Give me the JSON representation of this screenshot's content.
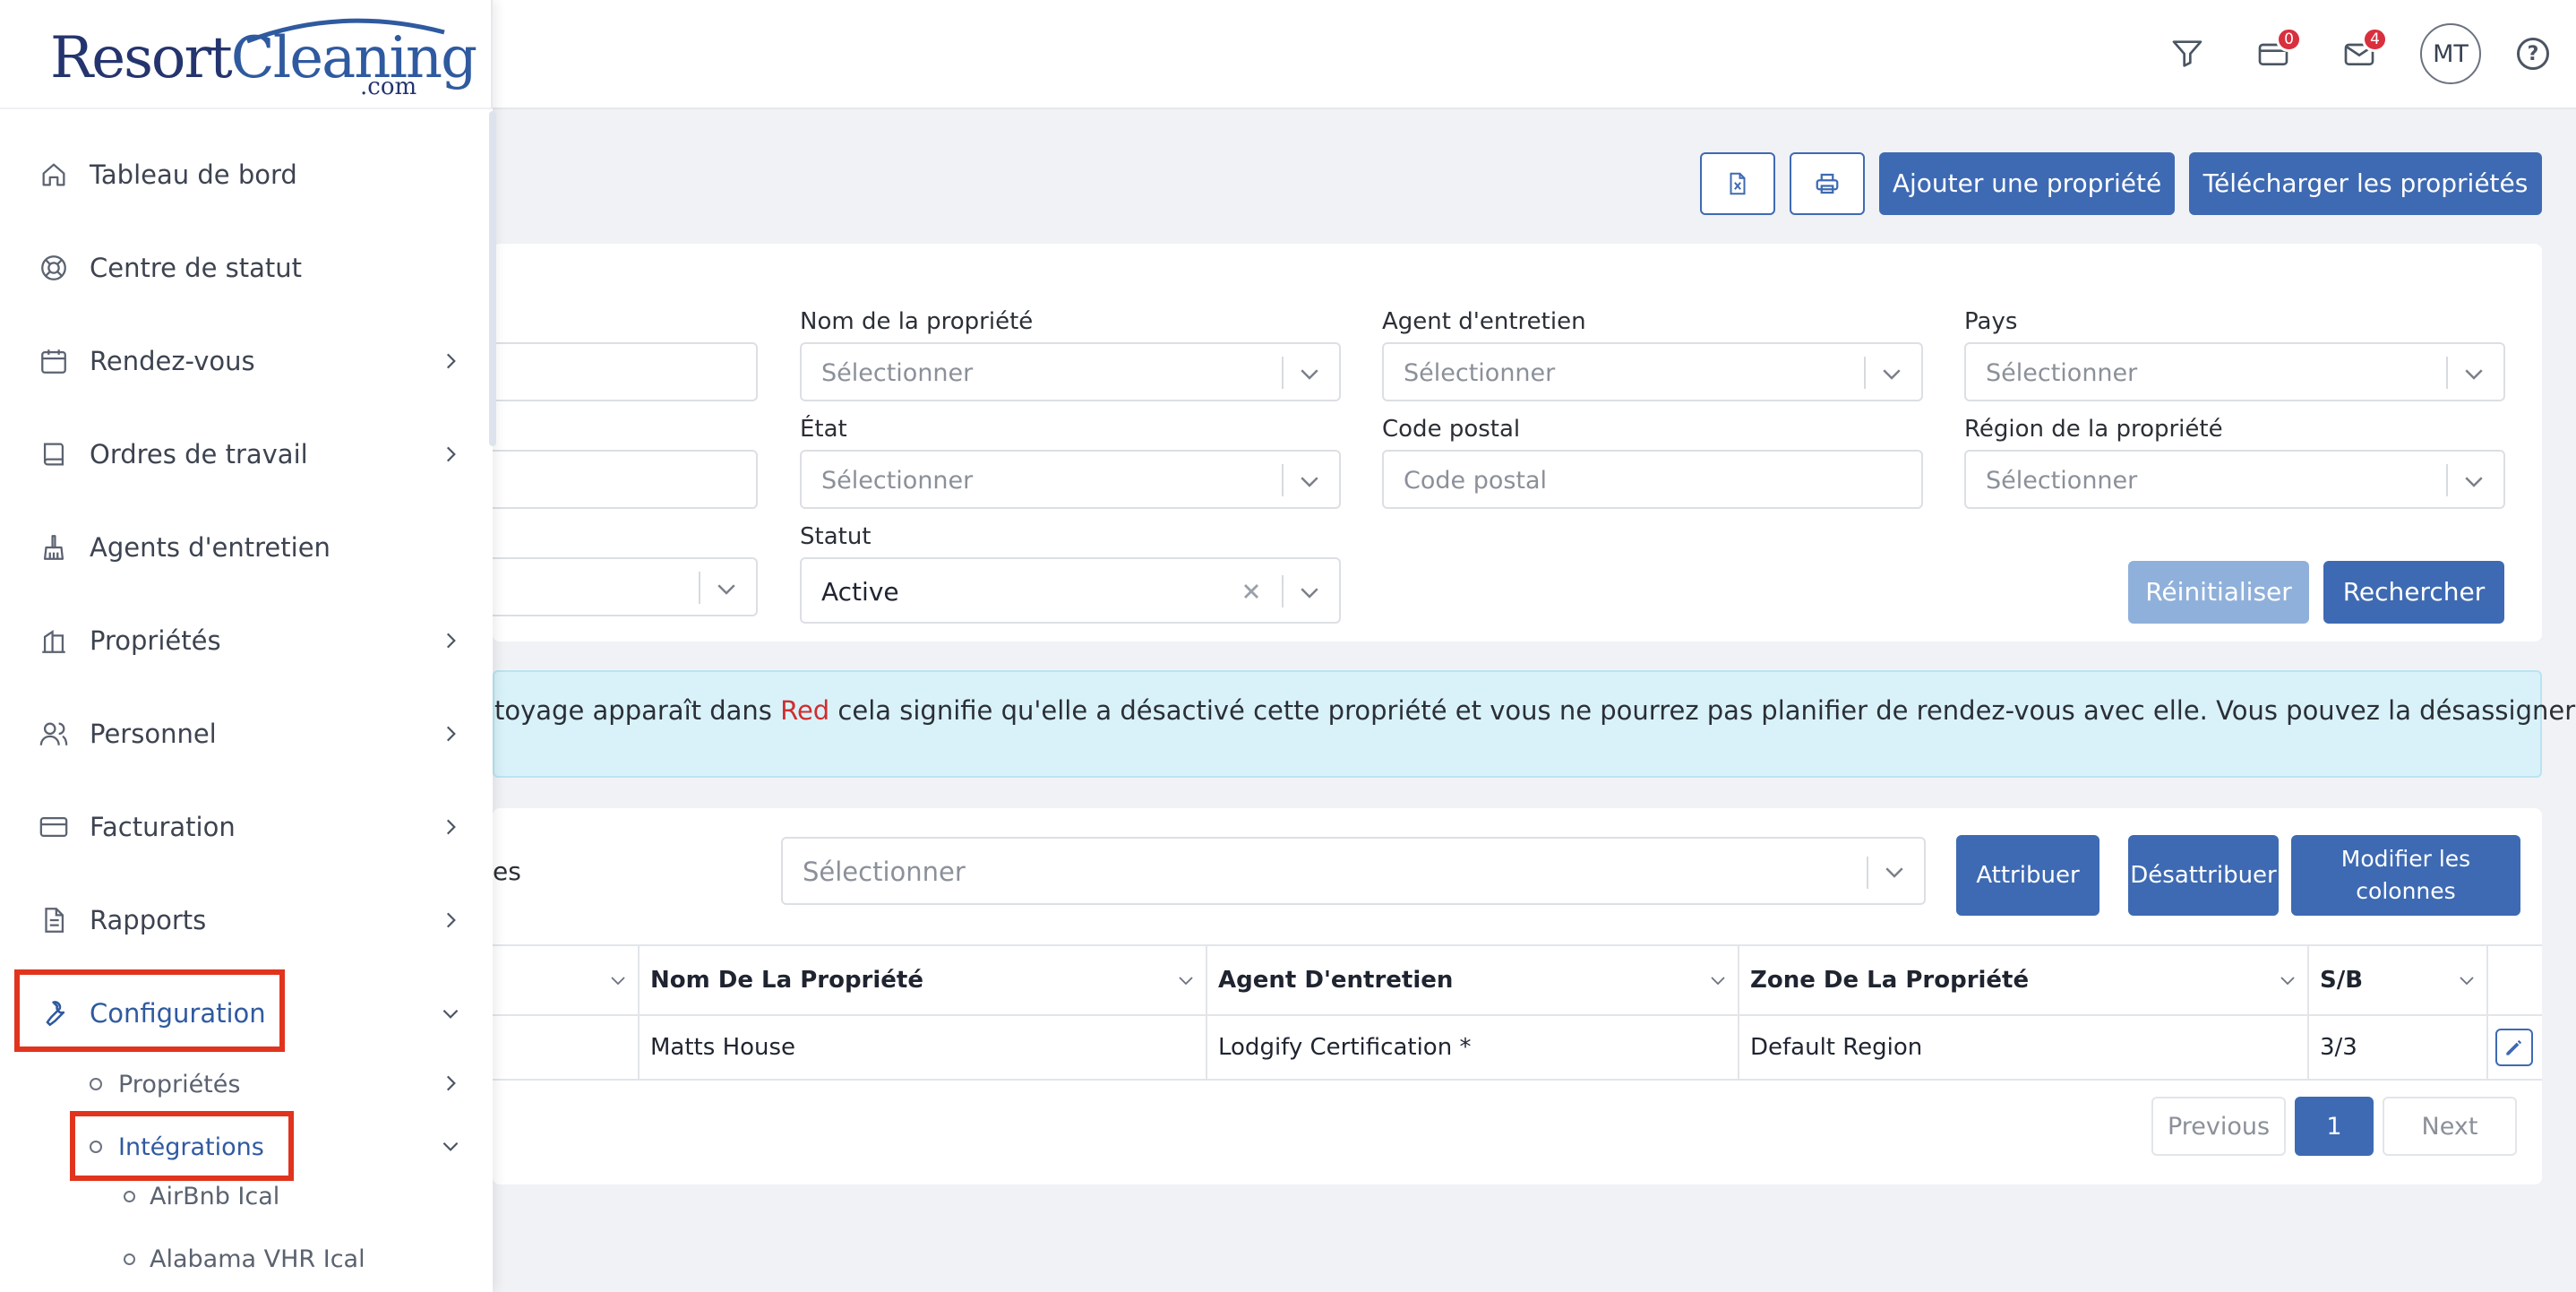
{
  "brand": {
    "logo_part1": "Resort",
    "logo_part2": "Cleaning",
    "logo_suffix": ".com"
  },
  "header": {
    "badges": {
      "cards": "0",
      "mail": "4"
    },
    "avatar_initials": "MT",
    "help_glyph": "?",
    "icons": [
      "filter-icon",
      "card-icon",
      "mail-icon",
      "help-icon"
    ]
  },
  "sidebar": {
    "items": [
      {
        "label": "Tableau de bord",
        "icon": "home-icon"
      },
      {
        "label": "Centre de statut",
        "icon": "lifebuoy-icon"
      },
      {
        "label": "Rendez-vous",
        "icon": "calendar-icon"
      },
      {
        "label": "Ordres de travail",
        "icon": "book-icon"
      },
      {
        "label": "Agents d'entretien",
        "icon": "broom-icon"
      },
      {
        "label": "Propriétés",
        "icon": "building-icon"
      },
      {
        "label": "Personnel",
        "icon": "users-icon"
      },
      {
        "label": "Facturation",
        "icon": "credit-card-icon"
      },
      {
        "label": "Rapports",
        "icon": "report-icon"
      },
      {
        "label": "Configuration",
        "icon": "wrench-icon"
      }
    ],
    "configuration_sub": [
      {
        "label": "Propriétés"
      },
      {
        "label": "Intégrations"
      }
    ],
    "integrations_sub": [
      {
        "label": "AirBnb Ical"
      },
      {
        "label": "Alabama VHR Ical"
      }
    ]
  },
  "toolbar": {
    "excel_icon": "excel-export-icon",
    "print_icon": "print-icon",
    "add_label": "Ajouter une propriété",
    "download_label": "Télécharger les propriétés"
  },
  "filters": {
    "property_name": {
      "label": "Nom de la propriété",
      "placeholder": "Sélectionner"
    },
    "agent": {
      "label": "Agent d'entretien",
      "placeholder": "Sélectionner"
    },
    "country": {
      "label": "Pays",
      "placeholder": "Sélectionner"
    },
    "state": {
      "label": "État",
      "placeholder": "Sélectionner"
    },
    "postal": {
      "label": "Code postal",
      "placeholder": "Code postal"
    },
    "region": {
      "label": "Région de la propriété",
      "placeholder": "Sélectionner"
    },
    "status": {
      "label": "Statut",
      "value": "Active"
    },
    "reset_label": "Réinitialiser",
    "search_label": "Rechercher"
  },
  "notice": {
    "text_before": "toyage apparaît dans ",
    "red_word": "Red",
    "text_after": " cela signifie qu'elle a désactivé cette propriété et vous ne pourrez pas planifier de rendez-vous avec elle. Vous pouvez la désassigner de la"
  },
  "assign_bar": {
    "left_fragment": "es",
    "placeholder": "Sélectionner",
    "assign_label": "Attribuer",
    "unassign_label": "Désattribuer",
    "columns_line1": "Modifier les",
    "columns_line2": "colonnes"
  },
  "table": {
    "headers": [
      "Nom De La Propriété",
      "Agent D'entretien",
      "Zone De La Propriété",
      "S/B"
    ],
    "rows": [
      [
        "Matts House",
        "Lodgify Certification *",
        "Default Region",
        "3/3"
      ]
    ]
  },
  "pagination": {
    "previous": "Previous",
    "page": "1",
    "next": "Next"
  }
}
